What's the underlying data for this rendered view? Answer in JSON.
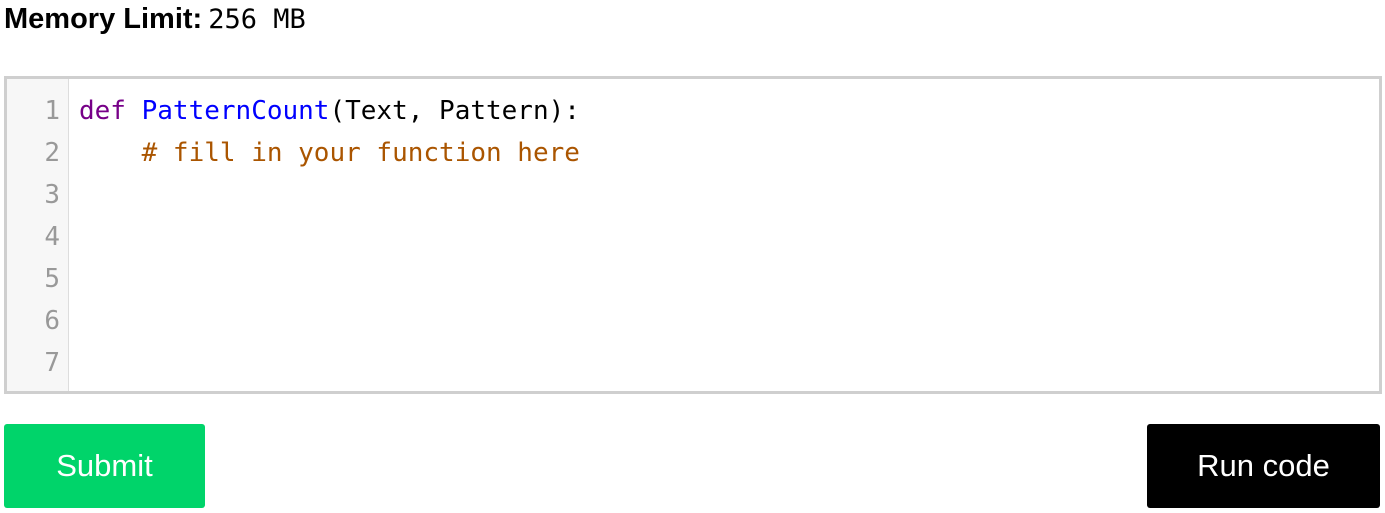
{
  "memory_limit": {
    "label": "Memory Limit:",
    "value": "256 MB"
  },
  "editor": {
    "line_numbers": [
      "1",
      "2",
      "3",
      "4",
      "5",
      "6",
      "7"
    ],
    "lines": [
      {
        "keyword": "def",
        "space": " ",
        "function": "PatternCount",
        "rest": "(Text, Pattern):"
      },
      {
        "indent": "    ",
        "comment": "# fill in your function here"
      },
      {
        "text": ""
      },
      {
        "text": ""
      },
      {
        "text": ""
      },
      {
        "text": ""
      },
      {
        "text": ""
      }
    ],
    "colors": {
      "keyword": "#770088",
      "function": "#0000ff",
      "comment": "#aa5500",
      "gutter_text": "#999999"
    }
  },
  "buttons": {
    "submit_label": "Submit",
    "run_label": "Run code",
    "submit_color": "#00d46a",
    "run_color": "#000000"
  }
}
